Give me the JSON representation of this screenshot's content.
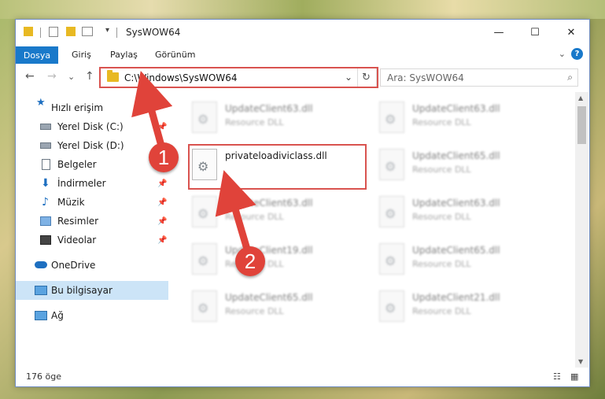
{
  "titlebar": {
    "title": "SysWOW64",
    "minimize": "—",
    "maximize": "☐",
    "close": "✕"
  },
  "ribbon": {
    "tabs": [
      "Dosya",
      "Giriş",
      "Paylaş",
      "Görünüm"
    ],
    "collapse_glyph": "⌄",
    "help": "?"
  },
  "address": {
    "back": "←",
    "forward": "→",
    "recent": "⌄",
    "up": "↑",
    "path": "C:\\Windows\\SysWOW64",
    "chevron": "⌄",
    "refresh": "↻"
  },
  "search": {
    "placeholder": "Ara: SysWOW64",
    "icon": "⌕"
  },
  "nav": {
    "items": [
      {
        "label": "Hızlı erişim",
        "icon": "star-icon"
      },
      {
        "label": "Yerel Disk (C:)",
        "icon": "drive-icon"
      },
      {
        "label": "Yerel Disk (D:)",
        "icon": "drive-icon"
      },
      {
        "label": "Belgeler",
        "icon": "document-icon"
      },
      {
        "label": "İndirmeler",
        "icon": "download-icon"
      },
      {
        "label": "Müzik",
        "icon": "music-icon"
      },
      {
        "label": "Resimler",
        "icon": "picture-icon"
      },
      {
        "label": "Videolar",
        "icon": "video-icon"
      },
      {
        "label": "OneDrive",
        "icon": "cloud-icon"
      },
      {
        "label": "Bu bilgisayar",
        "icon": "computer-icon"
      },
      {
        "label": "Ağ",
        "icon": "network-icon"
      }
    ]
  },
  "files": {
    "highlighted": {
      "name": "privateloadiviclass.dll"
    },
    "left": [
      {
        "name": "UpdateClient63.dll",
        "type": "Resource DLL"
      },
      {
        "name": "UpdateClient63.dll",
        "type": "Resource DLL"
      },
      {
        "name": "UpdateClient19.dll",
        "type": "Resource DLL"
      },
      {
        "name": "UpdateClient65.dll",
        "type": "Resource DLL"
      }
    ],
    "right": [
      {
        "name": "UpdateClient63.dll",
        "type": "Resource DLL"
      },
      {
        "name": "UpdateClient65.dll",
        "type": "Resource DLL"
      },
      {
        "name": "UpdateClient63.dll",
        "type": "Resource DLL"
      },
      {
        "name": "UpdateClient65.dll",
        "type": "Resource DLL"
      },
      {
        "name": "UpdateClient21.dll",
        "type": "Resource DLL"
      }
    ]
  },
  "status": {
    "count": "176 öge"
  },
  "annotations": {
    "step1": "1",
    "step2": "2",
    "color": "#e0433a"
  }
}
